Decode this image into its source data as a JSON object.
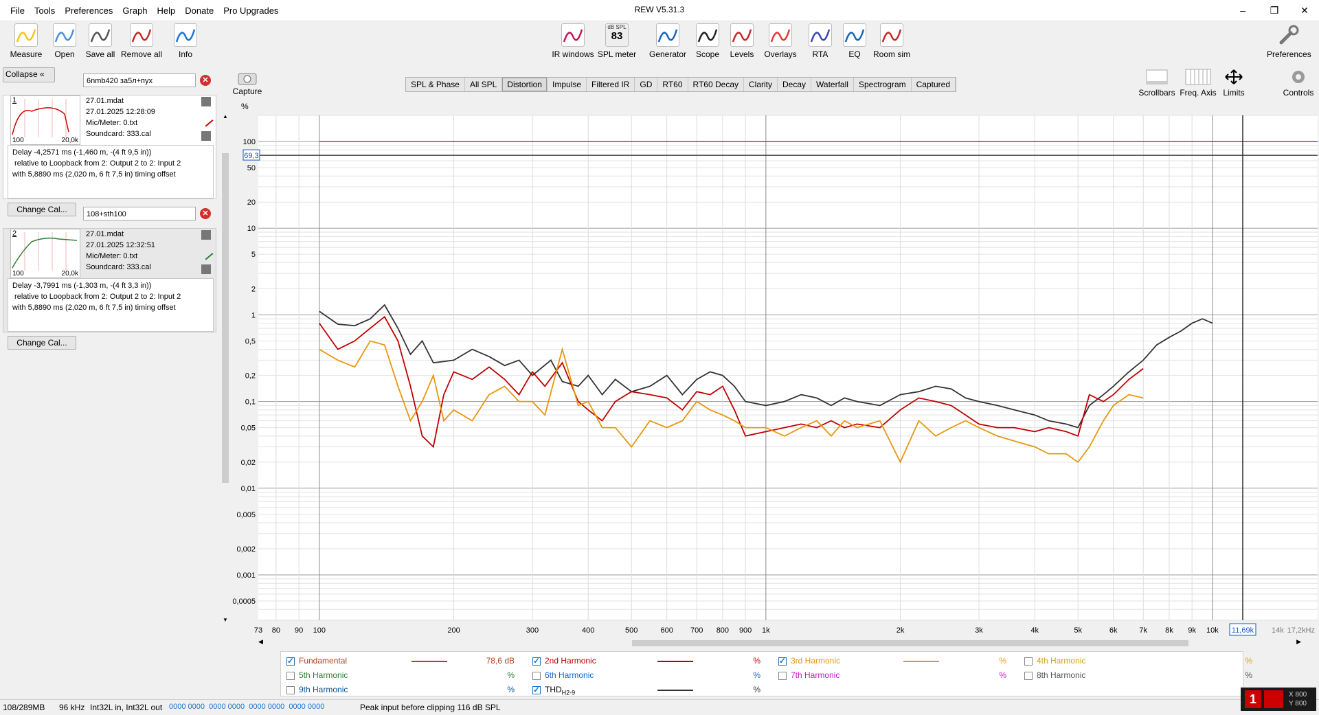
{
  "app": {
    "title": "REW V5.31.3"
  },
  "menu": [
    "File",
    "Tools",
    "Preferences",
    "Graph",
    "Help",
    "Donate",
    "Pro Upgrades"
  ],
  "toolbar_left": [
    {
      "label": "Measure",
      "icon": "measure-icon"
    },
    {
      "label": "Open",
      "icon": "folder-icon"
    },
    {
      "label": "Save all",
      "icon": "save-icon"
    },
    {
      "label": "Remove all",
      "icon": "remove-icon"
    },
    {
      "label": "Info",
      "icon": "info-icon"
    }
  ],
  "toolbar_center": [
    {
      "label": "IR windows",
      "icon": "ir-windows-icon"
    },
    {
      "label": "SPL meter",
      "icon": "spl-meter-icon",
      "badge_top": "dB SPL",
      "badge_value": "83"
    },
    {
      "label": "Generator",
      "icon": "generator-icon"
    },
    {
      "label": "Scope",
      "icon": "scope-icon"
    },
    {
      "label": "Levels",
      "icon": "levels-icon"
    },
    {
      "label": "Overlays",
      "icon": "overlays-icon"
    },
    {
      "label": "RTA",
      "icon": "rta-icon"
    },
    {
      "label": "EQ",
      "icon": "eq-icon"
    },
    {
      "label": "Room sim",
      "icon": "room-sim-icon"
    }
  ],
  "toolbar_right": {
    "preferences": "Preferences"
  },
  "left_panel": {
    "collapse": "Collapse",
    "measurements": [
      {
        "num": "1",
        "name": "6nmb420 за5л+пух",
        "file": "27.01.mdat",
        "date": "27.01.2025 12:28:09",
        "mic": "Mic/Meter: 0.txt",
        "soundcard": "Soundcard: 333.cal",
        "thumb_left": "100",
        "thumb_right": "20,0k",
        "delay": [
          "Delay -4,2571 ms (-1,460 m, -(4 ft 9,5 in))",
          " relative to Loopback from 2: Output 2 to 2: Input 2",
          "with 5,8890 ms (2,020 m, 6 ft 7,5 in) timing offset"
        ],
        "button": "Change Cal..."
      },
      {
        "num": "2",
        "name": "108+sth100",
        "file": "27.01.mdat",
        "date": "27.01.2025 12:32:51",
        "mic": "Mic/Meter: 0.txt",
        "soundcard": "Soundcard: 333.cal",
        "thumb_left": "100",
        "thumb_right": "20,0k",
        "delay": [
          "Delay -3,7991 ms (-1,303 m, -(4 ft 3,3 in))",
          " relative to Loopback from 2: Output 2 to 2: Input 2",
          "with 5,8890 ms (2,020 m, 6 ft 7,5 in) timing offset"
        ],
        "button": "Change Cal..."
      }
    ]
  },
  "graph_controls": {
    "capture": "Capture",
    "scrollbars": "Scrollbars",
    "freq_axis": "Freq. Axis",
    "limits": "Limits",
    "controls": "Controls"
  },
  "tabs": [
    "SPL & Phase",
    "All SPL",
    "Distortion",
    "Impulse",
    "Filtered IR",
    "GD",
    "RT60",
    "RT60 Decay",
    "Clarity",
    "Decay",
    "Waterfall",
    "Spectrogram",
    "Captured"
  ],
  "active_tab": "Distortion",
  "chart_data": {
    "type": "line",
    "ylabel": "%",
    "yscale": "log",
    "xscale": "log",
    "ylim": [
      0.0003,
      200
    ],
    "xlim": [
      73,
      17200
    ],
    "y_ticks": [
      {
        "v": 100,
        "t": "100"
      },
      {
        "v": 50,
        "t": "50"
      },
      {
        "v": 20,
        "t": "20"
      },
      {
        "v": 10,
        "t": "10"
      },
      {
        "v": 5,
        "t": "5"
      },
      {
        "v": 2,
        "t": "2"
      },
      {
        "v": 1,
        "t": "1"
      },
      {
        "v": 0.5,
        "t": "0,5"
      },
      {
        "v": 0.2,
        "t": "0,2"
      },
      {
        "v": 0.1,
        "t": "0,1"
      },
      {
        "v": 0.05,
        "t": "0,05"
      },
      {
        "v": 0.02,
        "t": "0,02"
      },
      {
        "v": 0.01,
        "t": "0,01"
      },
      {
        "v": 0.005,
        "t": "0,005"
      },
      {
        "v": 0.002,
        "t": "0,002"
      },
      {
        "v": 0.001,
        "t": "0,001"
      },
      {
        "v": 0.0005,
        "t": "0,0005"
      }
    ],
    "x_ticks": [
      {
        "v": 73,
        "t": "73"
      },
      {
        "v": 80,
        "t": "80"
      },
      {
        "v": 90,
        "t": "90"
      },
      {
        "v": 100,
        "t": "100"
      },
      {
        "v": 200,
        "t": "200"
      },
      {
        "v": 300,
        "t": "300"
      },
      {
        "v": 400,
        "t": "400"
      },
      {
        "v": 500,
        "t": "500"
      },
      {
        "v": 600,
        "t": "600"
      },
      {
        "v": 700,
        "t": "700"
      },
      {
        "v": 800,
        "t": "800"
      },
      {
        "v": 900,
        "t": "900"
      },
      {
        "v": 1000,
        "t": "1k"
      },
      {
        "v": 2000,
        "t": "2k"
      },
      {
        "v": 3000,
        "t": "3k"
      },
      {
        "v": 4000,
        "t": "4k"
      },
      {
        "v": 5000,
        "t": "5k"
      },
      {
        "v": 6000,
        "t": "6k"
      },
      {
        "v": 7000,
        "t": "7k"
      },
      {
        "v": 8000,
        "t": "8k"
      },
      {
        "v": 9000,
        "t": "9k"
      },
      {
        "v": 10000,
        "t": "10k"
      },
      {
        "v": 14000,
        "t": "14k"
      },
      {
        "v": 17200,
        "t": "17,2kHz"
      }
    ],
    "cursor": {
      "x": 11690,
      "x_label": "11,69k",
      "y": 69.3,
      "y_label": "69,3"
    },
    "series": [
      {
        "name": "Fundamental",
        "color": "#b0401e",
        "points": [
          [
            100,
            100
          ],
          [
            17200,
            100
          ]
        ]
      },
      {
        "name": "THD",
        "color": "#333333",
        "points": [
          [
            100,
            1.1
          ],
          [
            110,
            0.78
          ],
          [
            120,
            0.75
          ],
          [
            130,
            0.9
          ],
          [
            140,
            1.3
          ],
          [
            150,
            0.7
          ],
          [
            160,
            0.35
          ],
          [
            170,
            0.5
          ],
          [
            180,
            0.28
          ],
          [
            200,
            0.3
          ],
          [
            220,
            0.4
          ],
          [
            240,
            0.33
          ],
          [
            260,
            0.26
          ],
          [
            280,
            0.3
          ],
          [
            300,
            0.2
          ],
          [
            330,
            0.3
          ],
          [
            350,
            0.17
          ],
          [
            380,
            0.15
          ],
          [
            400,
            0.2
          ],
          [
            430,
            0.12
          ],
          [
            460,
            0.18
          ],
          [
            500,
            0.13
          ],
          [
            550,
            0.15
          ],
          [
            600,
            0.2
          ],
          [
            650,
            0.12
          ],
          [
            700,
            0.18
          ],
          [
            750,
            0.22
          ],
          [
            800,
            0.2
          ],
          [
            850,
            0.15
          ],
          [
            900,
            0.1
          ],
          [
            1000,
            0.09
          ],
          [
            1100,
            0.1
          ],
          [
            1200,
            0.12
          ],
          [
            1300,
            0.11
          ],
          [
            1400,
            0.09
          ],
          [
            1500,
            0.11
          ],
          [
            1600,
            0.1
          ],
          [
            1800,
            0.09
          ],
          [
            2000,
            0.12
          ],
          [
            2200,
            0.13
          ],
          [
            2400,
            0.15
          ],
          [
            2600,
            0.14
          ],
          [
            2800,
            0.11
          ],
          [
            3000,
            0.1
          ],
          [
            3300,
            0.09
          ],
          [
            3600,
            0.08
          ],
          [
            4000,
            0.07
          ],
          [
            4300,
            0.06
          ],
          [
            4700,
            0.055
          ],
          [
            5000,
            0.05
          ],
          [
            5300,
            0.09
          ],
          [
            5700,
            0.12
          ],
          [
            6000,
            0.15
          ],
          [
            6500,
            0.22
          ],
          [
            7000,
            0.3
          ],
          [
            7500,
            0.45
          ],
          [
            8000,
            0.55
          ],
          [
            8500,
            0.65
          ],
          [
            9000,
            0.8
          ],
          [
            9500,
            0.9
          ],
          [
            10000,
            0.8
          ]
        ]
      },
      {
        "name": "2nd Harmonic",
        "color": "#c00000",
        "points": [
          [
            100,
            0.8
          ],
          [
            110,
            0.4
          ],
          [
            120,
            0.5
          ],
          [
            130,
            0.7
          ],
          [
            140,
            0.95
          ],
          [
            150,
            0.5
          ],
          [
            160,
            0.15
          ],
          [
            170,
            0.04
          ],
          [
            180,
            0.03
          ],
          [
            190,
            0.12
          ],
          [
            200,
            0.22
          ],
          [
            220,
            0.18
          ],
          [
            240,
            0.25
          ],
          [
            260,
            0.18
          ],
          [
            280,
            0.12
          ],
          [
            300,
            0.22
          ],
          [
            320,
            0.15
          ],
          [
            350,
            0.28
          ],
          [
            380,
            0.1
          ],
          [
            400,
            0.08
          ],
          [
            430,
            0.06
          ],
          [
            460,
            0.1
          ],
          [
            500,
            0.13
          ],
          [
            550,
            0.12
          ],
          [
            600,
            0.11
          ],
          [
            650,
            0.08
          ],
          [
            700,
            0.13
          ],
          [
            750,
            0.12
          ],
          [
            800,
            0.15
          ],
          [
            850,
            0.08
          ],
          [
            900,
            0.04
          ],
          [
            1000,
            0.045
          ],
          [
            1100,
            0.05
          ],
          [
            1200,
            0.055
          ],
          [
            1300,
            0.05
          ],
          [
            1400,
            0.06
          ],
          [
            1500,
            0.05
          ],
          [
            1600,
            0.055
          ],
          [
            1800,
            0.05
          ],
          [
            2000,
            0.08
          ],
          [
            2200,
            0.11
          ],
          [
            2400,
            0.1
          ],
          [
            2600,
            0.09
          ],
          [
            2800,
            0.07
          ],
          [
            3000,
            0.055
          ],
          [
            3300,
            0.05
          ],
          [
            3600,
            0.05
          ],
          [
            4000,
            0.045
          ],
          [
            4300,
            0.05
          ],
          [
            4700,
            0.045
          ],
          [
            5000,
            0.04
          ],
          [
            5300,
            0.12
          ],
          [
            5700,
            0.1
          ],
          [
            6000,
            0.12
          ],
          [
            6500,
            0.18
          ],
          [
            7000,
            0.24
          ]
        ]
      },
      {
        "name": "3rd Harmonic",
        "color": "#e8960c",
        "points": [
          [
            100,
            0.4
          ],
          [
            110,
            0.3
          ],
          [
            120,
            0.25
          ],
          [
            130,
            0.5
          ],
          [
            140,
            0.45
          ],
          [
            150,
            0.15
          ],
          [
            160,
            0.06
          ],
          [
            170,
            0.1
          ],
          [
            180,
            0.2
          ],
          [
            190,
            0.06
          ],
          [
            200,
            0.08
          ],
          [
            220,
            0.06
          ],
          [
            240,
            0.12
          ],
          [
            260,
            0.15
          ],
          [
            280,
            0.1
          ],
          [
            300,
            0.1
          ],
          [
            320,
            0.07
          ],
          [
            350,
            0.4
          ],
          [
            380,
            0.09
          ],
          [
            400,
            0.1
          ],
          [
            430,
            0.05
          ],
          [
            460,
            0.05
          ],
          [
            500,
            0.03
          ],
          [
            550,
            0.06
          ],
          [
            600,
            0.05
          ],
          [
            650,
            0.06
          ],
          [
            700,
            0.1
          ],
          [
            750,
            0.08
          ],
          [
            800,
            0.07
          ],
          [
            850,
            0.06
          ],
          [
            900,
            0.05
          ],
          [
            1000,
            0.05
          ],
          [
            1100,
            0.04
          ],
          [
            1200,
            0.05
          ],
          [
            1300,
            0.06
          ],
          [
            1400,
            0.04
          ],
          [
            1500,
            0.06
          ],
          [
            1600,
            0.05
          ],
          [
            1800,
            0.06
          ],
          [
            2000,
            0.02
          ],
          [
            2200,
            0.06
          ],
          [
            2400,
            0.04
          ],
          [
            2600,
            0.05
          ],
          [
            2800,
            0.06
          ],
          [
            3000,
            0.05
          ],
          [
            3300,
            0.04
          ],
          [
            3600,
            0.035
          ],
          [
            4000,
            0.03
          ],
          [
            4300,
            0.025
          ],
          [
            4700,
            0.025
          ],
          [
            5000,
            0.02
          ],
          [
            5300,
            0.03
          ],
          [
            5700,
            0.06
          ],
          [
            6000,
            0.09
          ],
          [
            6500,
            0.12
          ],
          [
            7000,
            0.11
          ]
        ]
      }
    ]
  },
  "legend": [
    {
      "label": "Fundamental",
      "checked": true,
      "color": "#b0401e",
      "value": "78,6 dB",
      "line": true
    },
    {
      "label": "2nd Harmonic",
      "checked": true,
      "color": "#c00000",
      "value": "%",
      "line": true
    },
    {
      "label": "3rd Harmonic",
      "checked": true,
      "color": "#e8960c",
      "value": "%",
      "line": true
    },
    {
      "label": "4th Harmonic",
      "checked": false,
      "color": "#d4a017",
      "value": "%",
      "line": false
    },
    {
      "label": "5th Harmonic",
      "checked": false,
      "color": "#2e7d32",
      "value": "%",
      "line": false
    },
    {
      "label": "6th Harmonic",
      "checked": false,
      "color": "#1565c0",
      "value": "%",
      "line": false
    },
    {
      "label": "7th Harmonic",
      "checked": false,
      "color": "#c218c2",
      "value": "%",
      "line": false
    },
    {
      "label": "8th Harmonic",
      "checked": false,
      "color": "#555555",
      "value": "%",
      "line": false
    },
    {
      "label": "9th Harmonic",
      "checked": false,
      "color": "#0b5394",
      "value": "%",
      "line": false
    },
    {
      "label": "THD",
      "checked": true,
      "color": "#333333",
      "value": "%",
      "line": true,
      "subscript": "H2-9"
    }
  ],
  "status": {
    "memory": "108/289MB",
    "rate": "96 kHz",
    "format": "Int32L in, Int32L out",
    "levels": "0000 0000  0000 0000  0000 0000  0000 0000",
    "peak": "Peak input before clipping 116 dB SPL",
    "x": "X 800",
    "y": "Y 800"
  }
}
